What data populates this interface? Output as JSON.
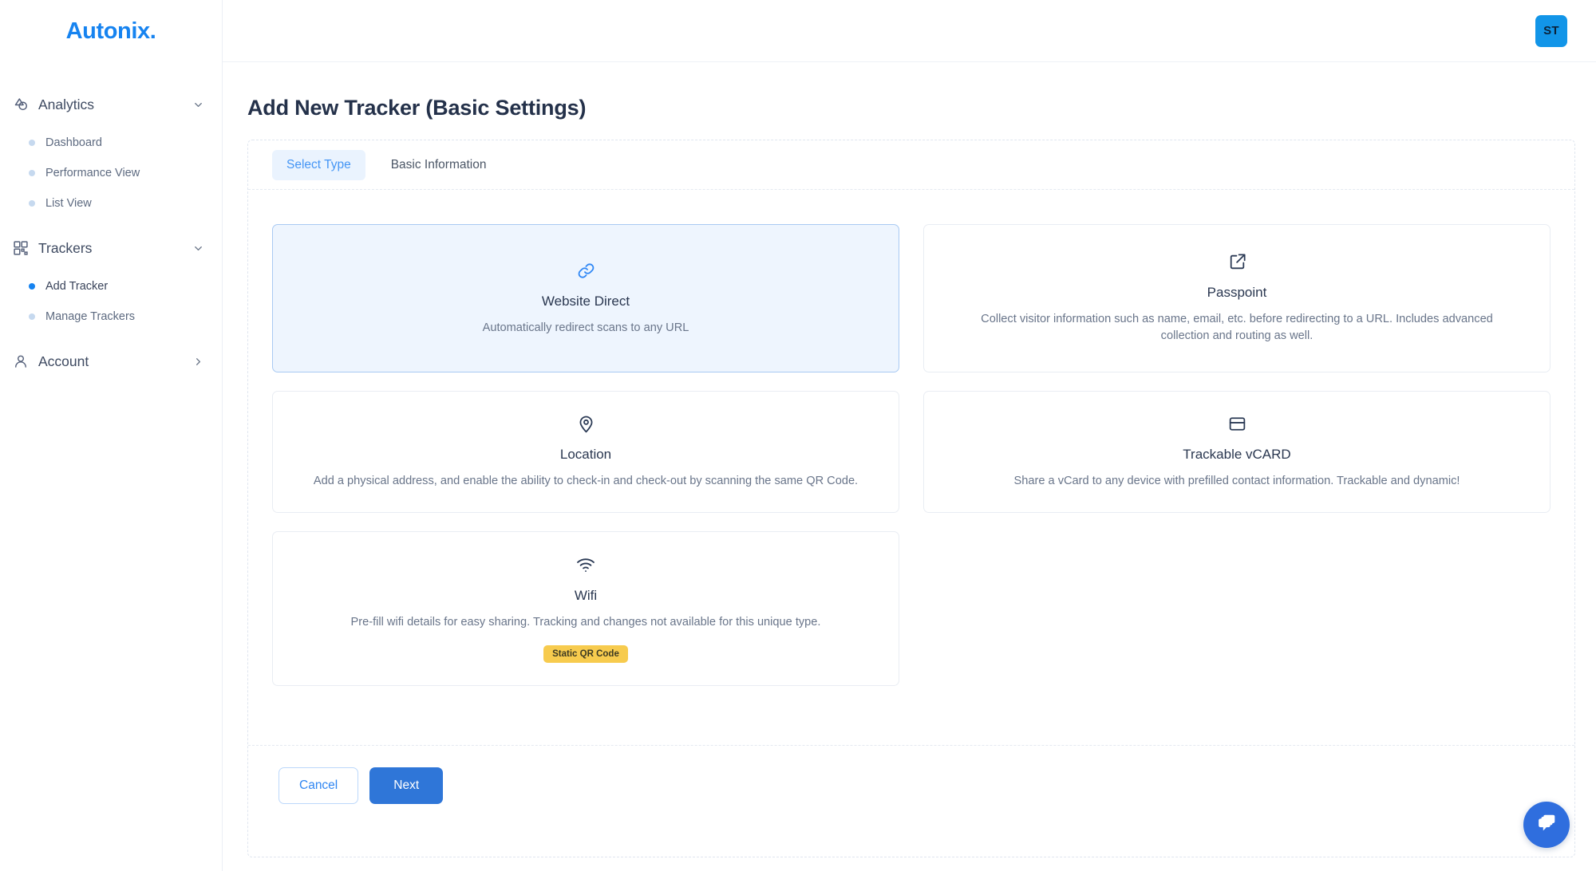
{
  "brand": {
    "name": "Autonix."
  },
  "topbar": {
    "avatar_initials": "ST"
  },
  "header": {
    "title": "Add New Tracker (Basic Settings)"
  },
  "sidebar": {
    "groups": [
      {
        "label": "Analytics",
        "icon": "analytics-icon",
        "chevron": "chevron-down-icon",
        "items": [
          {
            "label": "Dashboard",
            "active": false
          },
          {
            "label": "Performance View",
            "active": false
          },
          {
            "label": "List View",
            "active": false
          }
        ]
      },
      {
        "label": "Trackers",
        "icon": "qr-code-icon",
        "chevron": "chevron-down-icon",
        "items": [
          {
            "label": "Add Tracker",
            "active": true
          },
          {
            "label": "Manage Trackers",
            "active": false
          }
        ]
      },
      {
        "label": "Account",
        "icon": "user-icon",
        "chevron": "chevron-right-icon",
        "items": []
      }
    ]
  },
  "tabs": [
    {
      "label": "Select Type",
      "active": true
    },
    {
      "label": "Basic Information",
      "active": false
    }
  ],
  "tracker_types": [
    {
      "title": "Website Direct",
      "description": "Automatically redirect scans to any URL",
      "icon": "link-icon",
      "selected": true,
      "badge": null
    },
    {
      "title": "Passpoint",
      "description": "Collect visitor information such as name, email, etc. before redirecting to a URL. Includes advanced collection and routing as well.",
      "icon": "external-link-icon",
      "selected": false,
      "badge": null
    },
    {
      "title": "Location",
      "description": "Add a physical address, and enable the ability to check-in and check-out by scanning the same QR Code.",
      "icon": "map-pin-icon",
      "selected": false,
      "badge": null
    },
    {
      "title": "Trackable vCARD",
      "description": "Share a vCard to any device with prefilled contact information. Trackable and dynamic!",
      "icon": "card-icon",
      "selected": false,
      "badge": null
    },
    {
      "title": "Wifi",
      "description": "Pre-fill wifi details for easy sharing. Tracking and changes not available for this unique type.",
      "icon": "wifi-icon",
      "selected": false,
      "badge": "Static QR Code"
    }
  ],
  "footer": {
    "cancel_label": "Cancel",
    "next_label": "Next"
  },
  "chat": {
    "icon": "chat-bubbles-icon"
  },
  "colors": {
    "brand_blue": "#1683f0",
    "primary_button": "#2f76d8",
    "selected_card_bg": "#eef5fe",
    "selected_card_border": "#a9caf3",
    "badge_amber": "#f7cb4e",
    "avatar_bg": "#1295e8"
  }
}
